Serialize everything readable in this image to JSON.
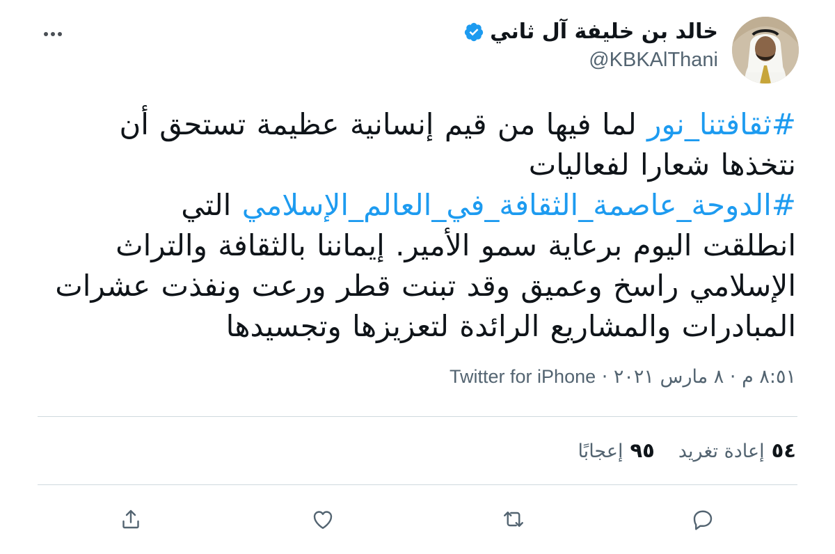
{
  "tweet": {
    "author_name": "خالد بن خليفة آل ثاني",
    "handle": "@KBKAlThani",
    "text_lines": [
      [
        {
          "hashtag": true,
          "text": "#ثقافتنا_نور"
        },
        {
          "hashtag": false,
          "text": " لما فيها من قيم إنسانية عظيمة تستحق أن"
        }
      ],
      [
        {
          "hashtag": false,
          "text": "نتخذها شعارا لفعاليات"
        }
      ],
      [
        {
          "hashtag": true,
          "text": "#الدوحة_عاصمة_الثقافة_في_العالم_الإسلامي"
        },
        {
          "hashtag": false,
          "text": " التي"
        }
      ],
      [
        {
          "hashtag": false,
          "text": "انطلقت اليوم برعاية سمو الأمير. إيماننا بالثقافة والتراث"
        }
      ],
      [
        {
          "hashtag": false,
          "text": "الإسلامي راسخ وعميق وقد تبنت قطر ورعت ونفذت عشرات"
        }
      ],
      [
        {
          "hashtag": false,
          "text": "المبادرات والمشاريع الرائدة لتعزيزها وتجسيدها"
        }
      ]
    ],
    "time": "٨:٥١ م",
    "date": "٨ مارس ٢٠٢١",
    "separator": "·",
    "source": "Twitter for iPhone",
    "retweets_count": "٥٤",
    "retweets_label": "إعادة تغريد",
    "likes_count": "٩٥",
    "likes_label": "إعجابًا"
  },
  "icons": {
    "more": "more-horizontal-icon",
    "verified": "verified-badge-icon",
    "reply": "reply-icon",
    "retweet": "retweet-icon",
    "like": "heart-icon",
    "share": "share-icon"
  },
  "colors": {
    "hashtag": "#1d9bf0",
    "verified": "#1d9bf0",
    "secondary_text": "#536471",
    "divider": "#cfd9de"
  }
}
